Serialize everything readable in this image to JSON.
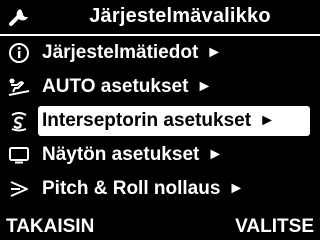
{
  "header": {
    "title": "Järjestelmävalikko",
    "icon": "wrench-icon"
  },
  "menu": {
    "items": [
      {
        "label": "Järjestelmätiedot",
        "icon": "info-icon",
        "selected": false
      },
      {
        "label": "AUTO asetukset",
        "icon": "autopilot-icon",
        "selected": false
      },
      {
        "label": "Interseptorin asetukset",
        "icon": "interceptor-icon",
        "selected": true
      },
      {
        "label": "Näytön asetukset",
        "icon": "display-icon",
        "selected": false
      },
      {
        "label": "Pitch & Roll nollaus",
        "icon": "pitch-roll-icon",
        "selected": false
      }
    ],
    "arrow": "►"
  },
  "footer": {
    "back_label": "TAKAISIN",
    "select_label": "VALITSE"
  },
  "colors": {
    "background": "#000000",
    "foreground": "#ffffff",
    "highlight_text": "#000000"
  }
}
